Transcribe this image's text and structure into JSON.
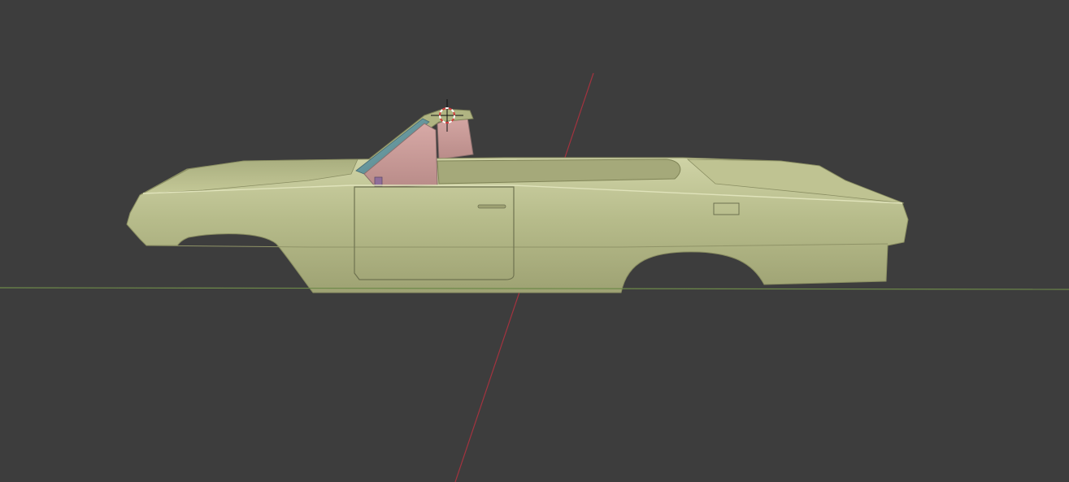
{
  "viewport": {
    "background_color": "#3d3d3d",
    "x_axis_color": "#6e8a4a",
    "y_axis_color": "#a3333f"
  },
  "model": {
    "body_color": "#b5ba88",
    "body_shadow_color": "#8f9569",
    "body_highlight_color": "#d2d6a8",
    "glass_color": "#5d8c93",
    "interior_color": "#c99a98"
  },
  "cursor_3d": {
    "icon": "3d-cursor-icon",
    "ring_color_a": "#ffffff",
    "ring_color_b": "#d23c3c"
  }
}
